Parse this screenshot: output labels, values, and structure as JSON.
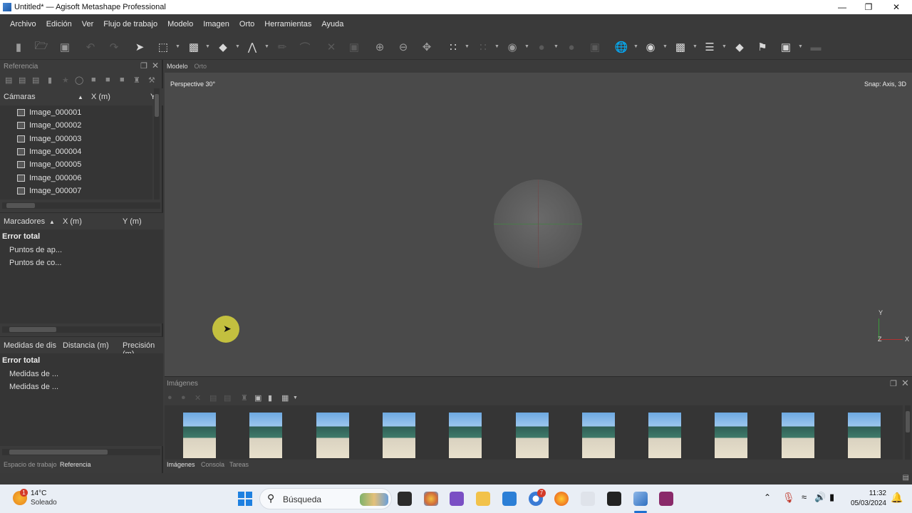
{
  "window": {
    "title": "Untitled* — Agisoft Metashape Professional"
  },
  "menu": [
    "Archivo",
    "Edición",
    "Ver",
    "Flujo de trabajo",
    "Modelo",
    "Imagen",
    "Orto",
    "Herramientas",
    "Ayuda"
  ],
  "reference_panel": {
    "title": "Referencia"
  },
  "cameras": {
    "headers": {
      "name": "Cámaras",
      "x": "X (m)",
      "y": "Y"
    },
    "items": [
      "Image_000001",
      "Image_000002",
      "Image_000003",
      "Image_000004",
      "Image_000005",
      "Image_000006",
      "Image_000007"
    ]
  },
  "markers": {
    "headers": {
      "name": "Marcadores",
      "x": "X (m)",
      "y": "Y (m)"
    },
    "group": "Error total",
    "items": [
      "Puntos de ap...",
      "Puntos de co..."
    ]
  },
  "scalebars": {
    "headers": {
      "name": "Medidas de dis",
      "distance": "Distancia (m)",
      "precision": "Precisión (m)"
    },
    "group": "Error total",
    "items": [
      "Medidas de ...",
      "Medidas de ..."
    ]
  },
  "left_tabs": [
    "Espacio de trabajo",
    "Referencia"
  ],
  "view_tabs": [
    "Modelo",
    "Orto"
  ],
  "viewport": {
    "projection": "Perspective 30°",
    "snap": "Snap: Axis, 3D",
    "axes": {
      "y": "Y",
      "z": "Z",
      "x": "X"
    }
  },
  "images_panel": {
    "title": "Imágenes",
    "thumbnail_count": 11
  },
  "bottom_tabs": [
    "Imágenes",
    "Consola",
    "Tareas"
  ],
  "taskbar": {
    "weather_temp": "14°C",
    "weather_desc": "Soleado",
    "weather_badge": "1",
    "search_placeholder": "Búsqueda",
    "clock_time": "11:32",
    "clock_date": "05/03/2024",
    "app_badge": "7"
  }
}
